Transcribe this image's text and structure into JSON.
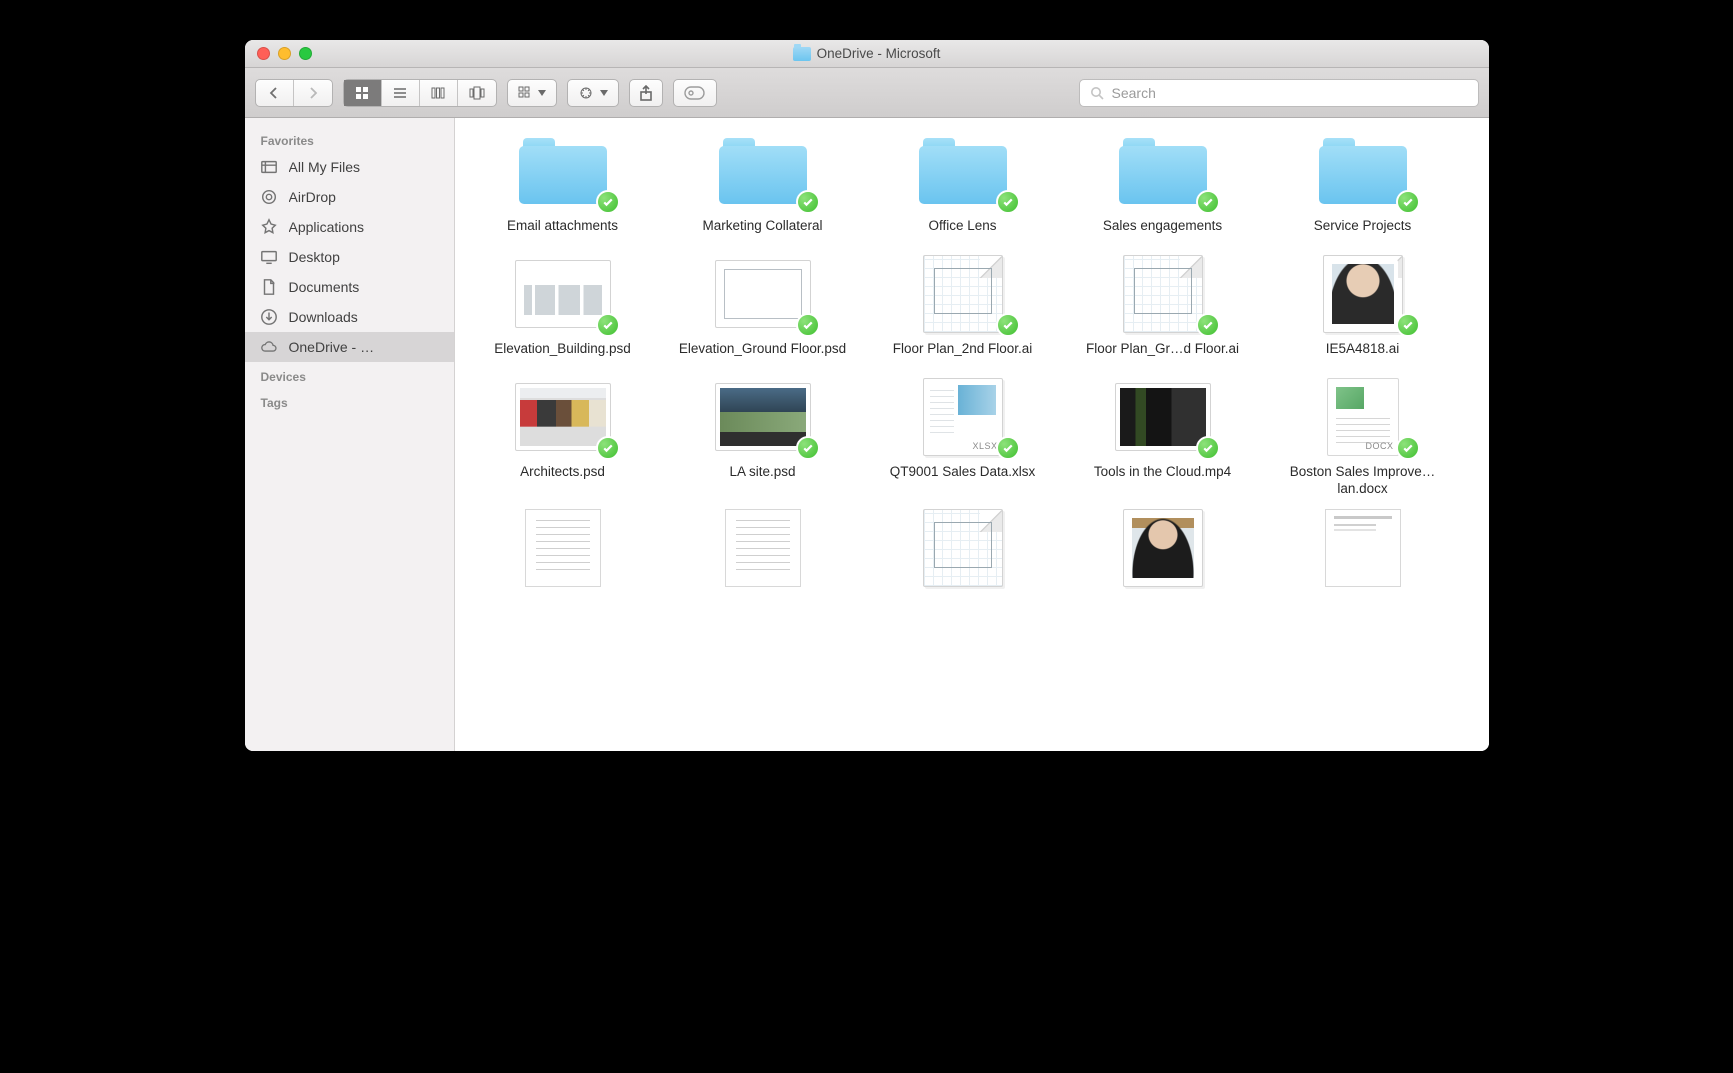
{
  "window": {
    "title": "OneDrive - Microsoft"
  },
  "toolbar": {
    "search_placeholder": "Search"
  },
  "sidebar": {
    "sections": [
      {
        "header": "Favorites",
        "items": [
          {
            "icon": "all-my-files-icon",
            "label": "All My Files"
          },
          {
            "icon": "airdrop-icon",
            "label": "AirDrop"
          },
          {
            "icon": "applications-icon",
            "label": "Applications"
          },
          {
            "icon": "desktop-icon",
            "label": "Desktop"
          },
          {
            "icon": "documents-icon",
            "label": "Documents"
          },
          {
            "icon": "downloads-icon",
            "label": "Downloads"
          },
          {
            "icon": "cloud-icon",
            "label": "OneDrive - …",
            "selected": true
          }
        ]
      },
      {
        "header": "Devices",
        "items": []
      },
      {
        "header": "Tags",
        "items": []
      }
    ]
  },
  "files": [
    {
      "kind": "folder",
      "name": "Email attachments",
      "synced": true
    },
    {
      "kind": "folder",
      "name": "Marketing Collateral",
      "synced": true
    },
    {
      "kind": "folder",
      "name": "Office Lens",
      "synced": true
    },
    {
      "kind": "folder",
      "name": "Sales engagements",
      "synced": true
    },
    {
      "kind": "folder",
      "name": "Service Projects",
      "synced": true
    },
    {
      "kind": "image",
      "thumb": "ph-elev",
      "name": "Elevation_Building.psd",
      "synced": true
    },
    {
      "kind": "image",
      "thumb": "ph-elev2",
      "name": "Elevation_Ground Floor.psd",
      "synced": true
    },
    {
      "kind": "doc",
      "thumb": "plan",
      "name": "Floor Plan_2nd Floor.ai",
      "synced": true
    },
    {
      "kind": "doc",
      "thumb": "plan",
      "name": "Floor Plan_Gr…d Floor.ai",
      "synced": true
    },
    {
      "kind": "doc",
      "thumb": "person",
      "name": "IE5A4818.ai",
      "synced": true
    },
    {
      "kind": "image",
      "thumb": "ph-store",
      "name": "Architects.psd",
      "synced": true
    },
    {
      "kind": "image",
      "thumb": "ph-la",
      "name": "LA site.psd",
      "synced": true
    },
    {
      "kind": "doc",
      "thumb": "xlsx",
      "ext": "XLSX",
      "name": "QT9001 Sales Data.xlsx",
      "synced": true
    },
    {
      "kind": "image",
      "thumb": "ph-cloud",
      "name": "Tools in the Cloud.mp4",
      "synced": true
    },
    {
      "kind": "doc",
      "thumb": "docx",
      "ext": "DOCX",
      "name": "Boston Sales Improve…lan.docx",
      "synced": true
    },
    {
      "kind": "doc",
      "thumb": "text",
      "name": ""
    },
    {
      "kind": "doc",
      "thumb": "text",
      "name": ""
    },
    {
      "kind": "doc",
      "thumb": "plan",
      "name": ""
    },
    {
      "kind": "doc",
      "thumb": "person2",
      "name": ""
    },
    {
      "kind": "doc",
      "thumb": "memo",
      "name": ""
    }
  ]
}
